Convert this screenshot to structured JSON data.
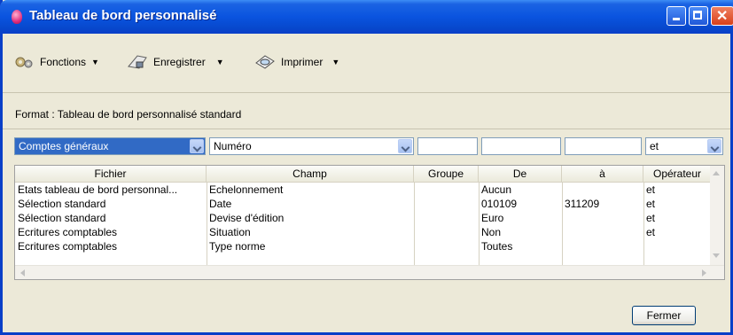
{
  "window": {
    "title": "Tableau de bord personnalisé"
  },
  "toolbar": {
    "functions_label": "Fonctions",
    "save_label": "Enregistrer",
    "print_label": "Imprimer"
  },
  "format_label": "Format : Tableau de bord personnalisé standard",
  "filters": {
    "fichier_value": "Comptes généraux",
    "champ_value": "Numéro",
    "groupe_value": "",
    "de_value": "",
    "a_value": "",
    "operateur_value": "et"
  },
  "table": {
    "columns": [
      "Fichier",
      "Champ",
      "Groupe",
      "De",
      "à",
      "Opérateur"
    ],
    "rows": [
      [
        "Etats tableau de bord personnal...",
        "Echelonnement",
        "",
        "Aucun",
        "",
        "et"
      ],
      [
        "Sélection standard",
        "Date",
        "",
        "010109",
        "311209",
        "et"
      ],
      [
        "Sélection standard",
        "Devise d'édition",
        "",
        "Euro",
        "",
        "et"
      ],
      [
        "Ecritures comptables",
        "Situation",
        "",
        "Non",
        "",
        "et"
      ],
      [
        "Ecritures comptables",
        "Type norme",
        "",
        "Toutes",
        "",
        ""
      ]
    ]
  },
  "footer": {
    "close_label": "Fermer"
  },
  "colors": {
    "title_bar": "#0a54df",
    "selection": "#316ac5",
    "window_bg": "#ece9d8"
  }
}
